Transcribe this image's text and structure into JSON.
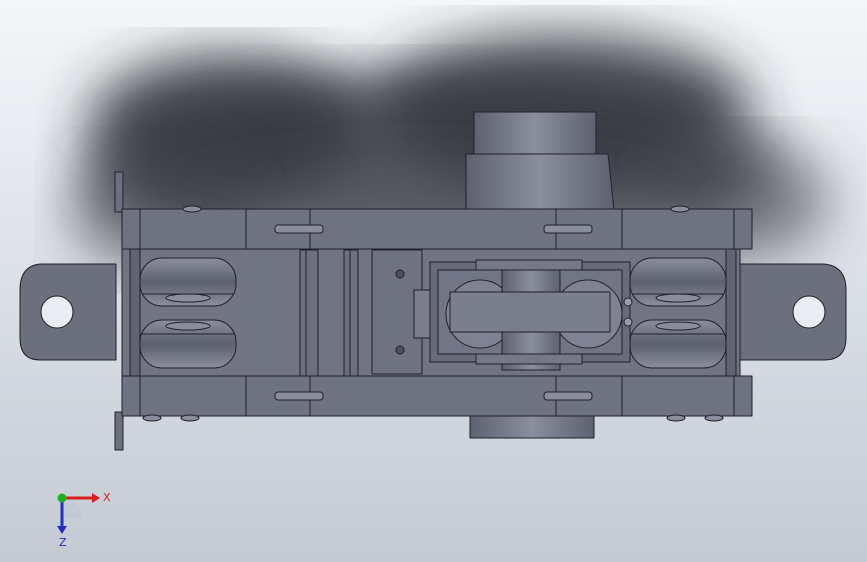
{
  "viewport": {
    "background_top": "#f4f6f9",
    "background_bottom": "#c4cad3",
    "part_color": "#6b6f7e",
    "part_color_light": "#7c8090",
    "edge_color": "#1f222b"
  },
  "triad": {
    "x_label": "X",
    "z_label": "Z",
    "x_color": "#d81e1e",
    "y_color": "#1bb31b",
    "z_color": "#1e2fc0"
  }
}
